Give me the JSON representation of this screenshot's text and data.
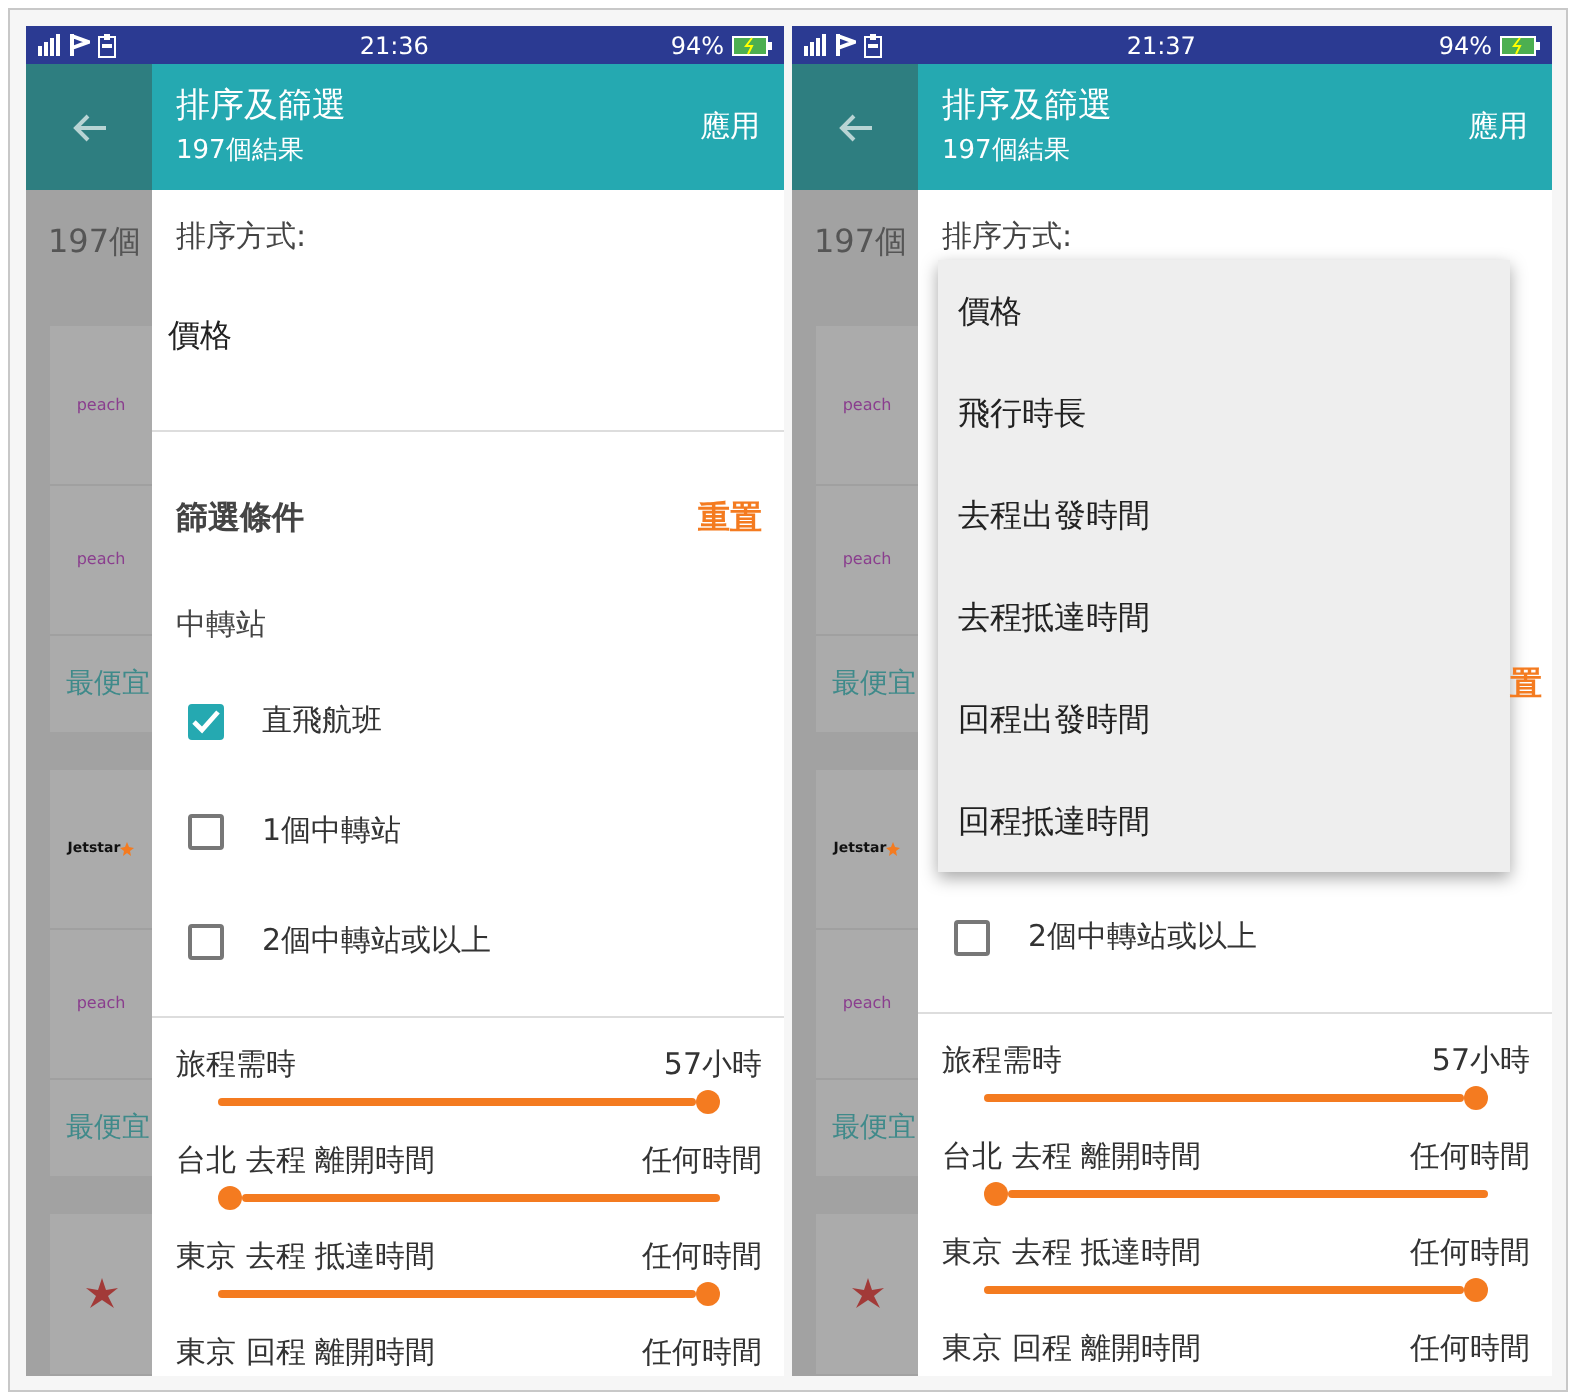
{
  "screens": [
    {
      "status_bar": {
        "time": "21:36",
        "battery": "94%"
      },
      "background": {
        "result_count": "197個",
        "cards": [
          {
            "logos": [
              {
                "kind": "peach",
                "text": "peach"
              },
              {
                "kind": "peach",
                "text": "peach"
              }
            ],
            "tag": "最便宜"
          },
          {
            "logos": [
              {
                "kind": "jetstar",
                "text": "Jetstar"
              },
              {
                "kind": "peach",
                "text": "peach"
              }
            ],
            "tag": "最便宜"
          },
          {
            "logos": [
              {
                "kind": "flower"
              }
            ]
          }
        ]
      },
      "panel": {
        "title": "排序及篩選",
        "subtitle": "197個結果",
        "apply": "應用",
        "sort_label": "排序方式:",
        "sort_value": "價格",
        "filter_title": "篩選條件",
        "reset": "重置",
        "stops_label": "中轉站",
        "stops": [
          {
            "label": "直飛航班",
            "checked": true
          },
          {
            "label": "1個中轉站",
            "checked": false
          },
          {
            "label": "2個中轉站或以上",
            "checked": false
          }
        ],
        "sliders": [
          {
            "label": "旅程需時",
            "value": "57小時",
            "level": 1
          },
          {
            "label": "台北 去程 離開時間",
            "value": "任何時間",
            "level": 0
          },
          {
            "label": "東京 去程 抵達時間",
            "value": "任何時間",
            "level": 1
          },
          {
            "label": "東京 回程 離開時間",
            "value": "任何時間"
          }
        ]
      }
    },
    {
      "status_bar": {
        "time": "21:37",
        "battery": "94%"
      },
      "background": {
        "result_count": "197個",
        "cards": [
          {
            "logos": [
              {
                "kind": "peach",
                "text": "peach"
              },
              {
                "kind": "peach",
                "text": "peach"
              }
            ],
            "tag": "最便宜"
          },
          {
            "logos": [
              {
                "kind": "jetstar",
                "text": "Jetstar"
              },
              {
                "kind": "peach",
                "text": "peach"
              }
            ],
            "tag": "最便宜"
          },
          {
            "logos": [
              {
                "kind": "flower"
              }
            ]
          }
        ]
      },
      "panel": {
        "title": "排序及篩選",
        "subtitle": "197個結果",
        "apply": "應用",
        "sort_label": "排序方式:",
        "reset": "置",
        "menu": [
          "價格",
          "飛行時長",
          "去程出發時間",
          "去程抵達時間",
          "回程出發時間",
          "回程抵達時間"
        ],
        "stops": [
          {
            "label": "2個中轉站或以上",
            "checked": false
          }
        ],
        "sliders": [
          {
            "label": "旅程需時",
            "value": "57小時",
            "level": 1
          },
          {
            "label": "台北 去程 離開時間",
            "value": "任何時間",
            "level": 0
          },
          {
            "label": "東京 去程 抵達時間",
            "value": "任何時間",
            "level": 1
          },
          {
            "label": "東京 回程 離開時間",
            "value": "任何時間"
          }
        ]
      }
    }
  ]
}
